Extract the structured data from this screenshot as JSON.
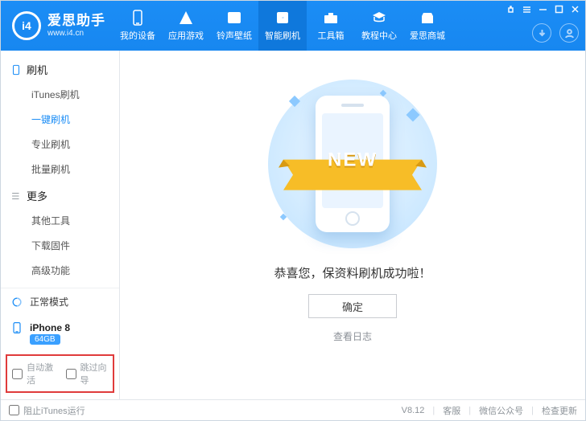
{
  "app": {
    "name": "爱思助手",
    "site": "www.i4.cn",
    "logo_mark": "i4"
  },
  "header_tabs": [
    {
      "label": "我的设备"
    },
    {
      "label": "应用游戏"
    },
    {
      "label": "铃声壁纸"
    },
    {
      "label": "智能刷机"
    },
    {
      "label": "工具箱"
    },
    {
      "label": "教程中心"
    },
    {
      "label": "爱思商城"
    }
  ],
  "active_tab_index": 3,
  "sidebar": {
    "group1": {
      "title": "刷机",
      "items": [
        "iTunes刷机",
        "一键刷机",
        "专业刷机",
        "批量刷机"
      ],
      "active_index": 1
    },
    "group2": {
      "title": "更多",
      "items": [
        "其他工具",
        "下载固件",
        "高级功能"
      ]
    }
  },
  "mode": {
    "label": "正常模式"
  },
  "device": {
    "name": "iPhone 8",
    "storage": "64GB"
  },
  "bottom_options": {
    "auto_activate": "自动激活",
    "skip_guide": "跳过向导"
  },
  "main": {
    "ribbon": "NEW",
    "success": "恭喜您，保资料刷机成功啦！",
    "ok": "确定",
    "view_log": "查看日志"
  },
  "footer": {
    "block_itunes": "阻止iTunes运行",
    "version": "V8.12",
    "support": "客服",
    "wechat": "微信公众号",
    "update": "检查更新"
  },
  "colors": {
    "primary": "#1b8df6"
  }
}
